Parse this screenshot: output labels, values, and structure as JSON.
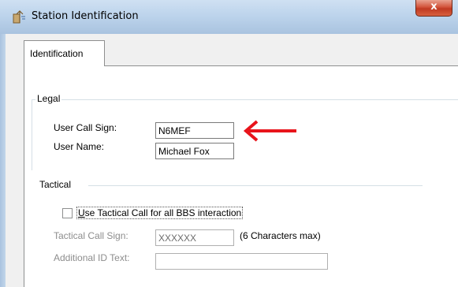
{
  "window": {
    "title": "Station Identification",
    "close_label": "x",
    "colors": {
      "frame": "#a9c3df",
      "close": "#c03a22",
      "client": "#f0f0f0"
    }
  },
  "tabs": [
    {
      "label": "Identification",
      "selected": true
    }
  ],
  "legal": {
    "legend": "Legal",
    "call_sign_label": "User Call Sign:",
    "call_sign_value": "N6MEF",
    "user_name_label": "User Name:",
    "user_name_value": "Michael Fox"
  },
  "annotation": {
    "arrow_color": "#e8141b",
    "icon": "red-arrow-icon"
  },
  "tactical": {
    "legend": "Tactical",
    "checkbox_label_prefix": "U",
    "checkbox_label_rest": "se Tactical Call for all BBS interaction",
    "checkbox_checked": false,
    "tactical_call_label": "Tactical Call Sign:",
    "tactical_call_value": "XXXXXX",
    "tactical_call_hint": "(6 Characters max)",
    "additional_id_label": "Additional ID Text:",
    "additional_id_value": ""
  }
}
